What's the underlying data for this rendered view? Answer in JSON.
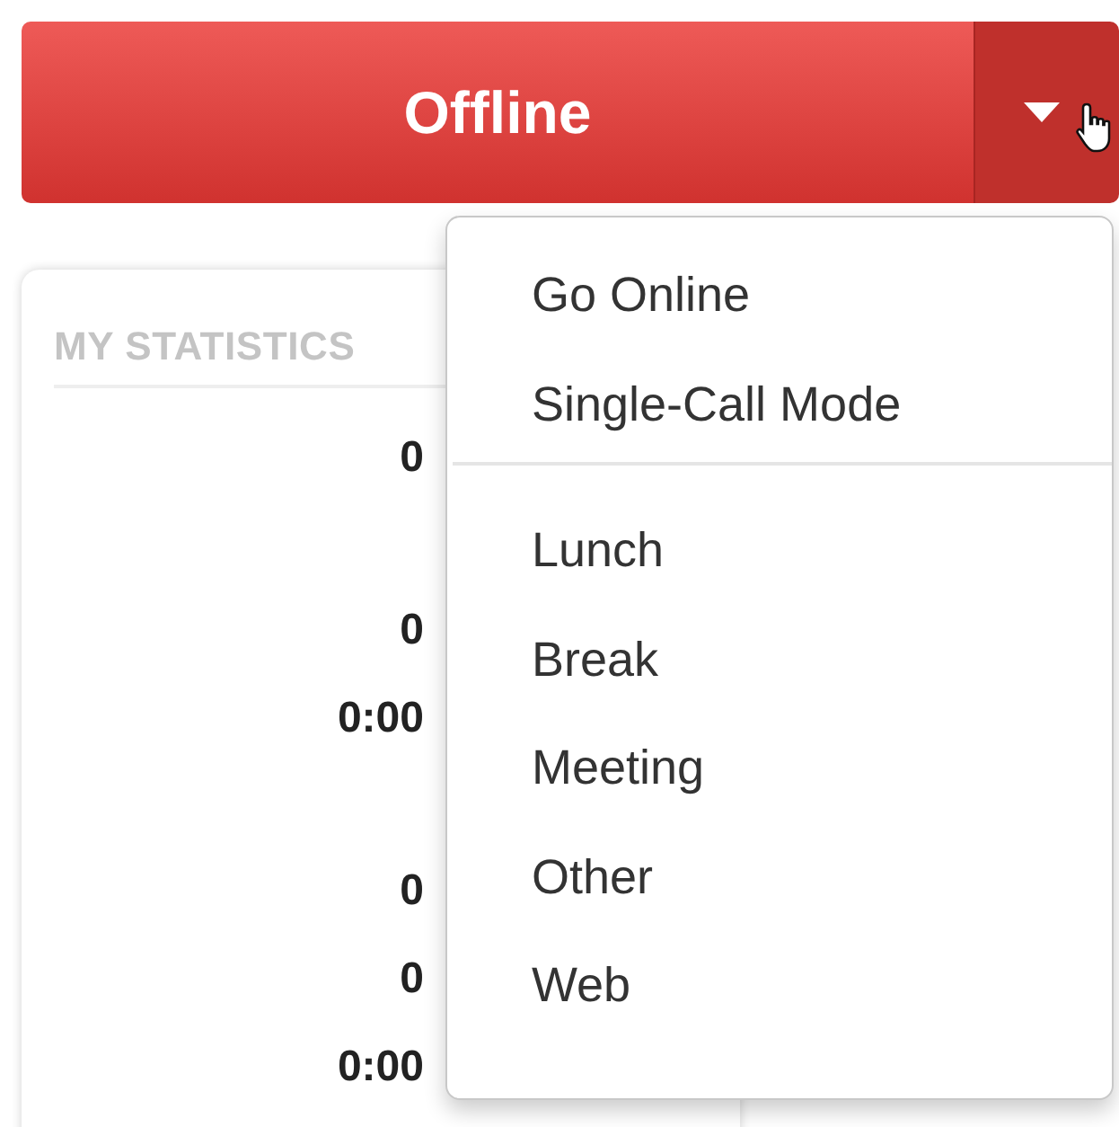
{
  "status_button": {
    "label": "Offline"
  },
  "statistics": {
    "title": "MY STATISTICS",
    "values": [
      "0",
      "0",
      "0:00",
      "0",
      "0",
      "0:00"
    ]
  },
  "menu": {
    "groups": [
      {
        "items": [
          "Go Online",
          "Single-Call Mode"
        ]
      },
      {
        "items": [
          "Lunch",
          "Break",
          "Meeting",
          "Other",
          "Web"
        ]
      }
    ]
  }
}
